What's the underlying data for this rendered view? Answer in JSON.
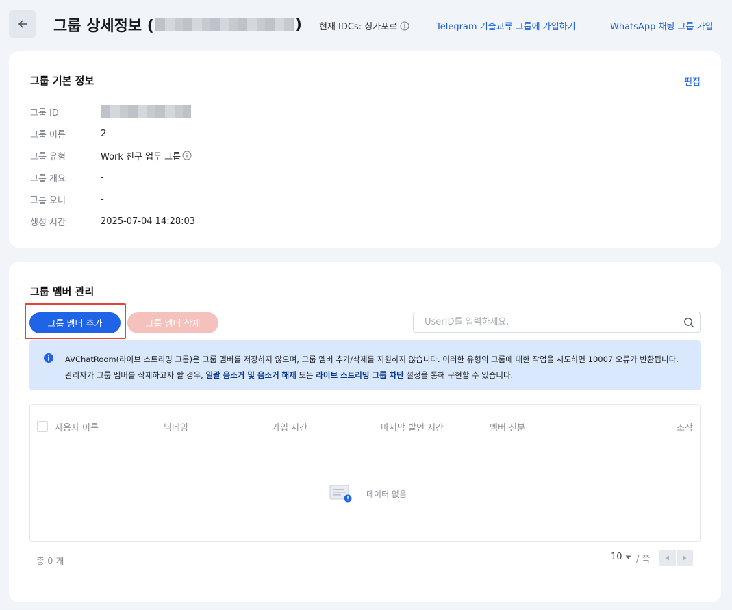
{
  "header": {
    "title": "그룹 상세정보 (",
    "title_close": ")",
    "idc_label": "현재 IDCs: 싱가포르",
    "telegram_link": "Telegram 기술교류 그룹에 가입하기",
    "whatsapp_link": "WhatsApp 채팅 그룹 가입"
  },
  "basic_info": {
    "title": "그룹 기본 정보",
    "edit_label": "편집",
    "rows": [
      {
        "label": "그룹 ID",
        "value": ""
      },
      {
        "label": "그룹 이름",
        "value": "2"
      },
      {
        "label": "그룹 유형",
        "value": "Work 친구 업무 그룹"
      },
      {
        "label": "그룹 개요",
        "value": "-"
      },
      {
        "label": "그룹 오너",
        "value": "-"
      },
      {
        "label": "생성 시간",
        "value": "2025-07-04 14:28:03"
      }
    ]
  },
  "members": {
    "title": "그룹 멤버 관리",
    "add_button": "그룹 멤버 추가",
    "delete_button": "그룹 멤버 삭제",
    "search_placeholder": "UserID를 입력하세요.",
    "notice": {
      "text_1": "AVChatRoom(라이브 스트리밍 그룹)은 그룹 멤버를 저장하지 않으며, 그룹 멤버 추가/삭제를 지원하지 않습니다. 이러한 유형의 그룹에 대한 작업을 시도하면 10007 오류가 반환됩니다. 관리자가 그룹 멤버를 삭제하고자 할 경우, ",
      "link_1": "일괄 음소거 및 음소거 해제",
      "text_2": " 또는 ",
      "link_2": "라이브 스트리밍 그룹 차단",
      "text_3": " 설정을 통해 구현할 수 있습니다."
    },
    "columns": [
      "사용자 이름",
      "닉네임",
      "가입 시간",
      "마지막 발언 시간",
      "멤버 신분",
      "조작"
    ],
    "empty_text": "데이터 없음",
    "total_label": "총 0 개",
    "page_size": "10",
    "per_page_label": "/ 쪽"
  },
  "colors": {
    "primary": "#1f63e6",
    "link": "#1a5fd6",
    "danger_disabled": "#f5c1bd",
    "highlight": "#e5443a",
    "notice_bg": "#d9e8fd"
  },
  "icons": [
    "back-arrow-icon",
    "info-icon",
    "search-icon",
    "empty-data-icon",
    "caret-down-icon",
    "prev-page-icon",
    "next-page-icon"
  ]
}
